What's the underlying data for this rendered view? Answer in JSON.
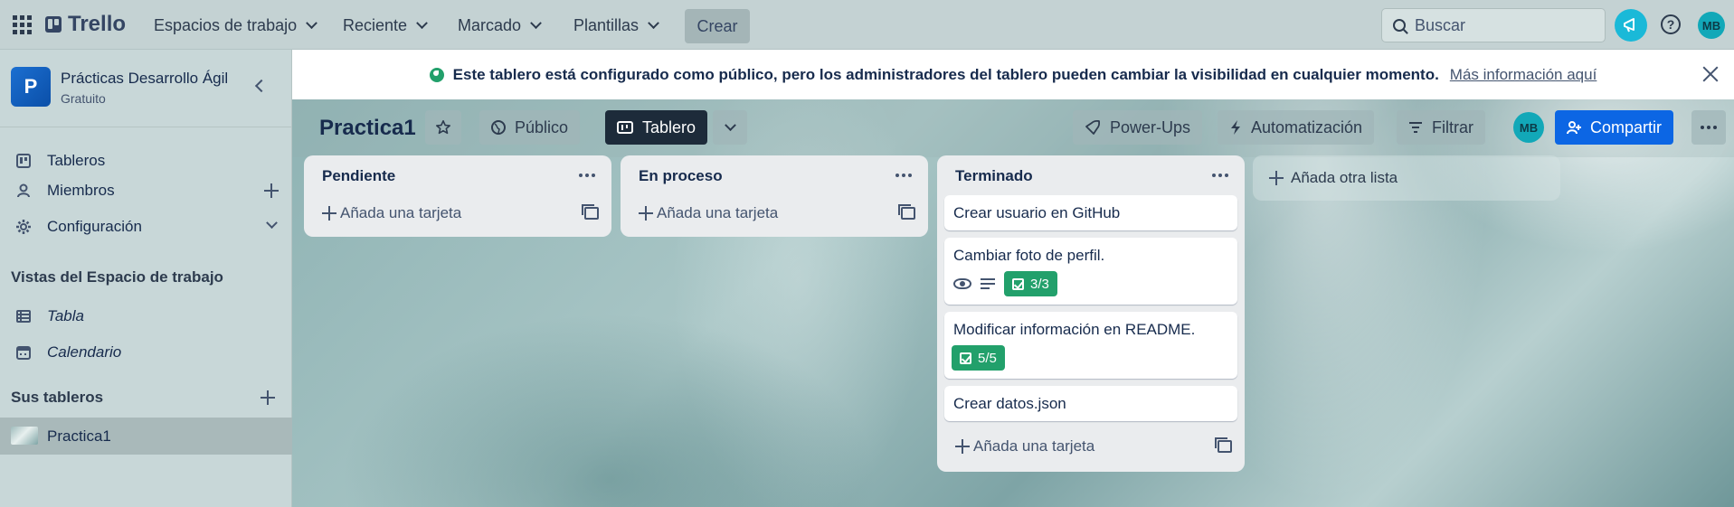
{
  "topbar": {
    "logo": "Trello",
    "nav": [
      {
        "label": "Espacios de trabajo"
      },
      {
        "label": "Reciente"
      },
      {
        "label": "Marcado"
      },
      {
        "label": "Plantillas"
      }
    ],
    "create_label": "Crear",
    "search_placeholder": "Buscar",
    "avatar_initials": "MB"
  },
  "sidebar": {
    "workspace_initial": "P",
    "workspace_name": "Prácticas Desarrollo Ágil",
    "workspace_plan": "Gratuito",
    "items": [
      {
        "label": "Tableros"
      },
      {
        "label": "Miembros"
      },
      {
        "label": "Configuración"
      }
    ],
    "views_heading": "Vistas del Espacio de trabajo",
    "views": [
      {
        "label": "Tabla"
      },
      {
        "label": "Calendario"
      }
    ],
    "boards_heading": "Sus tableros",
    "boards": [
      {
        "label": "Practica1"
      }
    ]
  },
  "banner": {
    "text": "Este tablero está configurado como público, pero los administradores del tablero pueden cambiar la visibilidad en cualquier momento.",
    "link": "Más información aquí"
  },
  "board": {
    "title": "Practica1",
    "visibility_label": "Público",
    "view_label": "Tablero",
    "powerups_label": "Power-Ups",
    "automation_label": "Automatización",
    "filter_label": "Filtrar",
    "member_initials": "MB",
    "share_label": "Compartir",
    "add_list_label": "Añada otra lista"
  },
  "lists": [
    {
      "title": "Pendiente",
      "add_card_label": "Añada una tarjeta",
      "cards": []
    },
    {
      "title": "En proceso",
      "add_card_label": "Añada una tarjeta",
      "cards": []
    },
    {
      "title": "Terminado",
      "add_card_label": "Añada una tarjeta",
      "cards": [
        {
          "title": "Crear usuario en GitHub"
        },
        {
          "title": "Cambiar foto de perfil.",
          "checklist": "3/3"
        },
        {
          "title": "Modificar información en README.",
          "checklist": "5/5"
        },
        {
          "title": "Crear datos.json"
        }
      ]
    }
  ],
  "colors": {
    "accent": "#0c66e4",
    "complete_badge": "#22a06b",
    "notification": "#1ab9d8",
    "view_button": "#1d2b3a"
  },
  "icons": [
    "apps-grid-icon",
    "trello-logo-icon",
    "chevron-down-icon",
    "search-icon",
    "megaphone-icon",
    "help-icon",
    "chevron-left-icon",
    "board-icon",
    "person-icon",
    "gear-icon",
    "plus-icon",
    "table-icon",
    "calendar-icon",
    "globe-icon",
    "close-icon",
    "star-icon",
    "rocket-icon",
    "lightning-icon",
    "filter-icon",
    "share-person-icon",
    "more-icon",
    "template-icon",
    "eye-icon",
    "description-icon",
    "checklist-icon"
  ]
}
